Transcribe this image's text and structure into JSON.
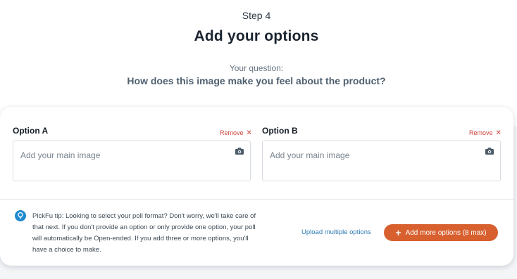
{
  "header": {
    "step": "Step 4",
    "title": "Add your options",
    "question_label": "Your question:",
    "question": "How does this image make you feel about the product?"
  },
  "options": [
    {
      "label": "Option A",
      "remove_label": "Remove",
      "placeholder": "Add your main image",
      "icon": "camera-icon"
    },
    {
      "label": "Option B",
      "remove_label": "Remove",
      "placeholder": "Add your main image",
      "icon": "camera-icon"
    }
  ],
  "footer": {
    "tip": "PickFu tip: Looking to select your poll format? Don't worry, we'll take care of that next. If you don't provide an option or only provide one option, your poll will automatically be Open-ended. If you add three or more options, you'll have a choice to make.",
    "tip_icon": "lightbulb-icon",
    "upload_label": "Upload multiple options",
    "add_label": "Add more options (8 max)"
  },
  "colors": {
    "accent": "#d8602f",
    "link": "#2c7ab2",
    "remove": "#d0433a",
    "tip_icon": "#1f8ad0"
  }
}
